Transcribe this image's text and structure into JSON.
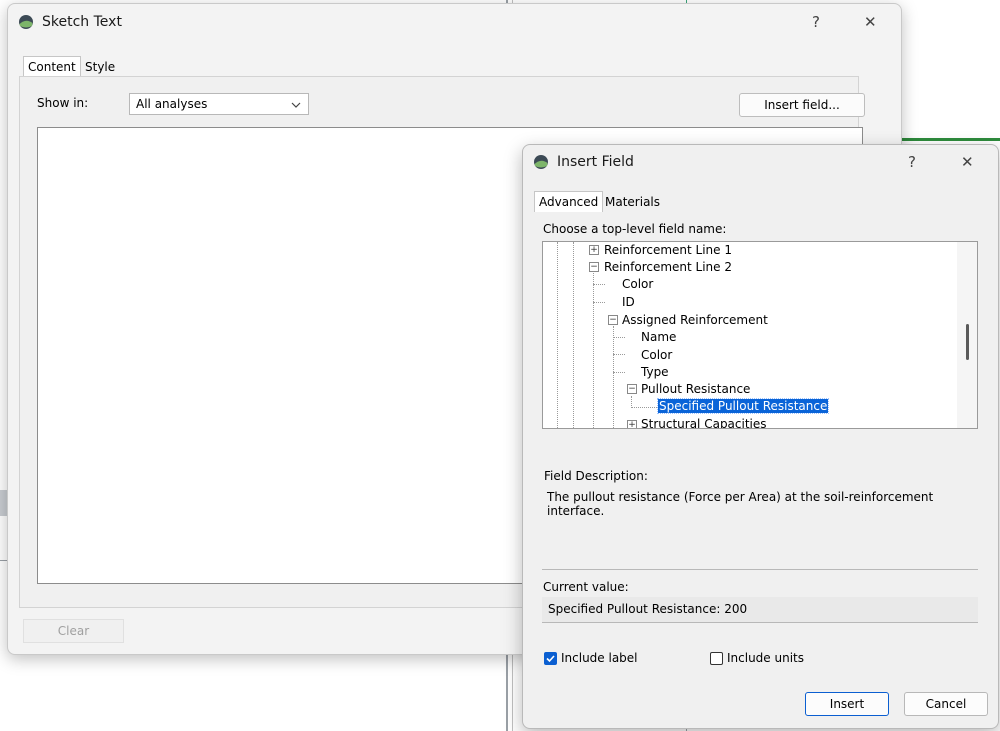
{
  "sketch_window": {
    "title": "Sketch Text",
    "help_glyph": "?",
    "close_glyph": "✕",
    "tabs": [
      "Content",
      "Style"
    ],
    "show_in_label": "Show in:",
    "show_in_value": "All analyses",
    "insert_field_button": "Insert field...",
    "content_text": "",
    "clear_button": "Clear"
  },
  "insert_field_dialog": {
    "title": "Insert Field",
    "help_glyph": "?",
    "close_glyph": "✕",
    "tabs": [
      "Advanced",
      "Materials"
    ],
    "choose_label": "Choose a top-level field name:",
    "tree": [
      {
        "label": "Reinforcement Line 1",
        "expander": "+"
      },
      {
        "label": "Reinforcement Line 2",
        "expander": "−"
      },
      {
        "label": "Color"
      },
      {
        "label": "ID"
      },
      {
        "label": "Assigned Reinforcement",
        "expander": "−"
      },
      {
        "label": "Name"
      },
      {
        "label": "Color"
      },
      {
        "label": "Type"
      },
      {
        "label": "Pullout Resistance",
        "expander": "−"
      },
      {
        "label": "Specified Pullout Resistance",
        "selected": true
      },
      {
        "label": "Structural Capacities",
        "expander": "+"
      }
    ],
    "field_description_label": "Field Description:",
    "field_description": "The pullout resistance (Force per Area) at the soil-reinforcement interface.",
    "current_value_label": "Current value:",
    "current_value": "Specified Pullout Resistance: 200",
    "include_label": {
      "label": "Include label",
      "checked": true
    },
    "include_units": {
      "label": "Include units",
      "checked": false
    },
    "insert_button": "Insert",
    "cancel_button": "Cancel"
  },
  "colors": {
    "selection": "#0a64d8",
    "checkbox_checked": "#0b5fd1",
    "window_bg": "#f3f3f3",
    "dialog_bg": "#f0f0f0"
  }
}
